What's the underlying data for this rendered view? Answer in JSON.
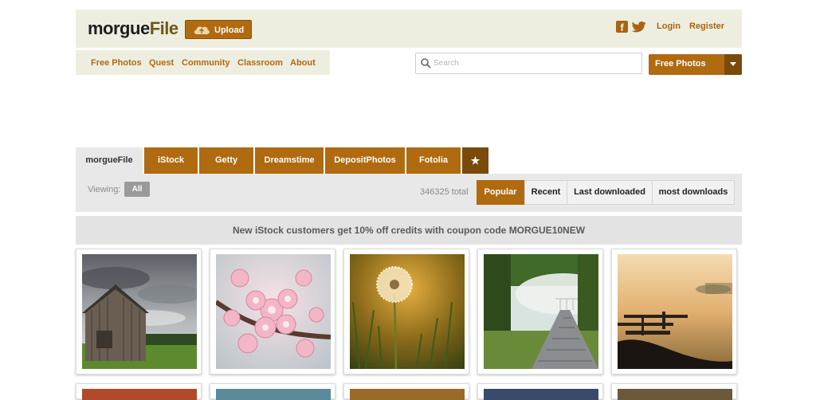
{
  "header": {
    "logo_part1": "morgue",
    "logo_part2": "File",
    "upload_label": "Upload",
    "facebook_icon": "facebook-icon",
    "twitter_icon": "twitter-icon",
    "login": "Login",
    "register": "Register"
  },
  "nav": {
    "items": [
      "Free Photos",
      "Quest",
      "Community",
      "Classroom",
      "About"
    ]
  },
  "search": {
    "placeholder": "Search",
    "icon": "search-icon"
  },
  "source_select": {
    "value": "Free Photos",
    "icon": "chevron-down-icon"
  },
  "tabs": [
    {
      "label": "morgueFile",
      "active": true
    },
    {
      "label": "iStock"
    },
    {
      "label": "Getty"
    },
    {
      "label": "Dreamstime"
    },
    {
      "label": "DepositPhotos"
    },
    {
      "label": "Fotolia"
    },
    {
      "label": "★",
      "icon": "star-icon"
    }
  ],
  "filter": {
    "viewing_label": "Viewing:",
    "viewing_value": "All",
    "total": "346325 total"
  },
  "sort": [
    {
      "label": "Popular",
      "active": true
    },
    {
      "label": "Recent"
    },
    {
      "label": "Last downloaded"
    },
    {
      "label": "most downloads"
    }
  ],
  "banner": "New iStock customers get 10% off credits with coupon code MORGUE10NEW",
  "colors": {
    "accent": "#b06a10",
    "accent_dark": "#7a4a0a",
    "header_bg": "#eeeee0",
    "panel_bg": "#e8e8e8"
  },
  "photos": [
    {
      "icon": "barn-photo"
    },
    {
      "icon": "cherry-blossom-photo"
    },
    {
      "icon": "dandelion-photo"
    },
    {
      "icon": "foggy-boardwalk-photo"
    },
    {
      "icon": "sunset-dock-photo"
    }
  ]
}
